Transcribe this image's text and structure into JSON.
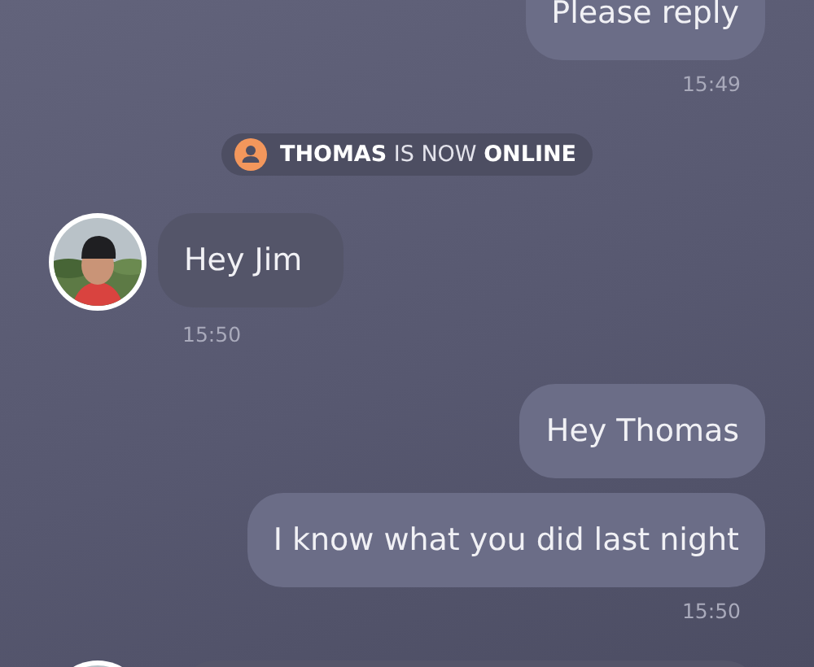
{
  "messages": [
    {
      "kind": "outgoing",
      "text": "Please reply"
    },
    {
      "kind": "time",
      "text": "15:49"
    },
    {
      "kind": "notice",
      "text": "**THOMAS** IS NOW **ONLINE**"
    },
    {
      "kind": "incoming",
      "text": "Hey Jim"
    },
    {
      "kind": "time",
      "text": "15:50"
    },
    {
      "kind": "outgoing",
      "text": "Hey Thomas"
    },
    {
      "kind": "outgoing",
      "text": "I know what you did last night"
    },
    {
      "kind": "time",
      "text": "15:50"
    },
    {
      "kind": "incoming"
    }
  ]
}
